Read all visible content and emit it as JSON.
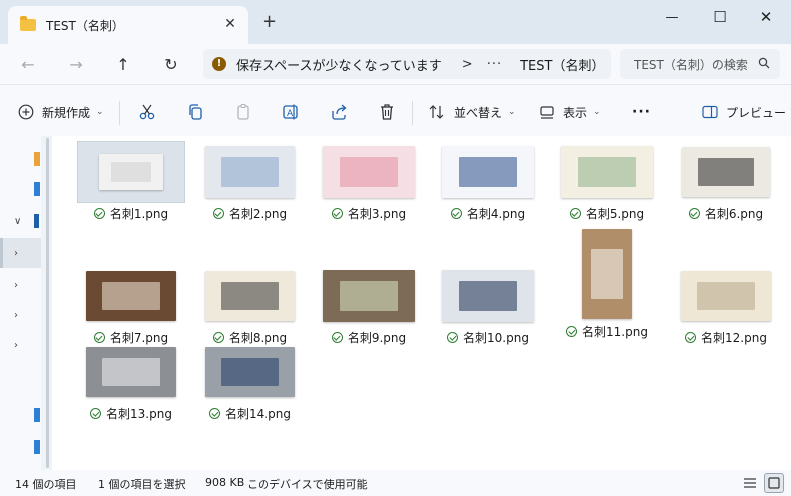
{
  "window": {
    "tab_title": "TEST（名刺）",
    "close_tab": "✕",
    "new_tab": "+",
    "minimize": "—",
    "maximize": "☐",
    "close": "✕"
  },
  "nav": {
    "back": "←",
    "forward": "→",
    "up": "↑",
    "refresh": "↻",
    "warning_text": "保存スペースが少なくなっています",
    "separator": ">",
    "more": "···",
    "current_folder": "TEST（名刺）",
    "search_placeholder": "TEST（名刺）の検索"
  },
  "toolbar": {
    "new_label": "新規作成",
    "sort_label": "並べ替え",
    "view_label": "表示",
    "more_label": "···",
    "preview_label": "プレビュー"
  },
  "files": [
    {
      "name": "名刺1.png",
      "status": "synced",
      "selected": true,
      "thumb": {
        "bg": "#f1f1f1",
        "accent": "#cfcfcf"
      }
    },
    {
      "name": "名刺2.png",
      "status": "synced",
      "thumb": {
        "bg": "#e3e8ef",
        "accent": "#8aa5c8"
      }
    },
    {
      "name": "名刺3.png",
      "status": "synced",
      "thumb": {
        "bg": "#f6dfe4",
        "accent": "#e48fa3"
      }
    },
    {
      "name": "名刺4.png",
      "status": "synced",
      "thumb": {
        "bg": "#f4f6f9",
        "accent": "#2b4f8c"
      }
    },
    {
      "name": "名刺5.png",
      "status": "synced",
      "thumb": {
        "bg": "#f3efe3",
        "accent": "#8fb08b"
      }
    },
    {
      "name": "名刺6.png",
      "status": "synced",
      "thumb": {
        "bg": "#ece9e2",
        "accent": "#2a2a2a"
      }
    },
    {
      "name": "名刺7.png",
      "status": "synced",
      "thumb": {
        "bg": "#6a4a33",
        "accent": "#f3e9d8"
      }
    },
    {
      "name": "名刺8.png",
      "status": "synced",
      "thumb": {
        "bg": "#efe9dc",
        "accent": "#3a3a3a"
      }
    },
    {
      "name": "名刺9.png",
      "status": "synced",
      "thumb": {
        "bg": "#7d6a57",
        "accent": "#d8e6c3"
      }
    },
    {
      "name": "名刺10.png",
      "status": "synced",
      "thumb": {
        "bg": "#dfe4ea",
        "accent": "#1e2f52"
      }
    },
    {
      "name": "名刺11.png",
      "status": "synced",
      "thumb": {
        "bg": "#b08e6a",
        "accent": "#f7f5f1"
      }
    },
    {
      "name": "名刺12.png",
      "status": "synced",
      "thumb": {
        "bg": "#efe7d6",
        "accent": "#b7a78a"
      }
    },
    {
      "name": "名刺13.png",
      "status": "synced",
      "thumb": {
        "bg": "#8c8f94",
        "accent": "#f2f2f2"
      }
    },
    {
      "name": "名刺14.png",
      "status": "synced",
      "thumb": {
        "bg": "#9aa0a8",
        "accent": "#1f3a66"
      }
    }
  ],
  "status": {
    "count": "14 個の項目",
    "selection": "1 個の項目を選択",
    "size": "908 KB",
    "availability": "このデバイスで使用可能"
  },
  "colors": {
    "synced_check": "#2e7d32",
    "selection_bg": "#dbe2ea",
    "warning": "#8a5a00"
  }
}
